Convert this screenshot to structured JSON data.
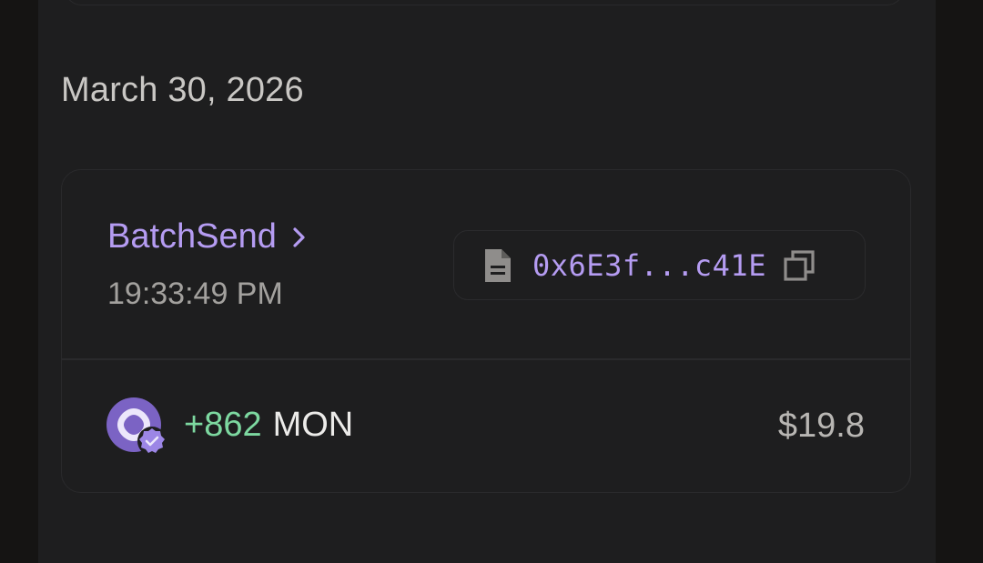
{
  "date_heading": "March 30, 2026",
  "transaction": {
    "method": "BatchSend",
    "time": "19:33:49 PM",
    "hash_short": "0x6E3f...c41E",
    "token": {
      "amount": "+862",
      "symbol": "MON",
      "usd_value": "$19.8",
      "icon": "monad-token-icon",
      "badge_icon": "verified-badge-icon"
    }
  },
  "colors": {
    "accent": "#b59cf2",
    "positive": "#7dd8a0",
    "panel_bg": "#1e1e1f",
    "outer_bg": "#151413",
    "border": "#2a2a2c"
  }
}
